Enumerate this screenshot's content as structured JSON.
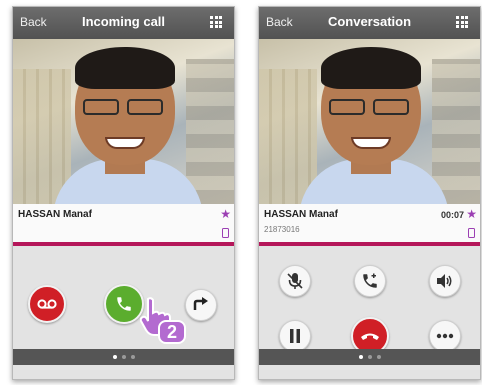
{
  "screens": [
    {
      "back_label": "Back",
      "title": "Incoming call",
      "caller_name": "HASSAN Manaf",
      "actions": [
        {
          "name": "voicemail-button",
          "icon": "voicemail-icon",
          "color": "#d01f26"
        },
        {
          "name": "answer-button",
          "icon": "phone-handset-icon",
          "color": "#5bad2e"
        },
        {
          "name": "forward-call-button",
          "icon": "forward-arrow-icon"
        }
      ],
      "annotation": "2",
      "page_dots": 3,
      "active_dot": 0
    },
    {
      "back_label": "Back",
      "title": "Conversation",
      "caller_name": "HASSAN Manaf",
      "caller_number": "21873016",
      "duration": "00:07",
      "actions": [
        {
          "name": "mute-button",
          "icon": "mic-off-icon"
        },
        {
          "name": "add-call-button",
          "icon": "add-call-icon"
        },
        {
          "name": "speaker-button",
          "icon": "speaker-icon"
        },
        {
          "name": "hold-button",
          "icon": "pause-icon"
        },
        {
          "name": "hang-up-button",
          "icon": "hang-up-icon",
          "color": "#d01f26"
        },
        {
          "name": "more-button",
          "icon": "more-dots-icon"
        }
      ],
      "page_dots": 3,
      "active_dot": 0
    }
  ],
  "colors": {
    "topbar": "#5e5e5e",
    "accent": "#b5175a",
    "favorite": "#9b3fb3",
    "red": "#d01f26",
    "green": "#5bad2e",
    "annotation": "#b36ad0"
  }
}
